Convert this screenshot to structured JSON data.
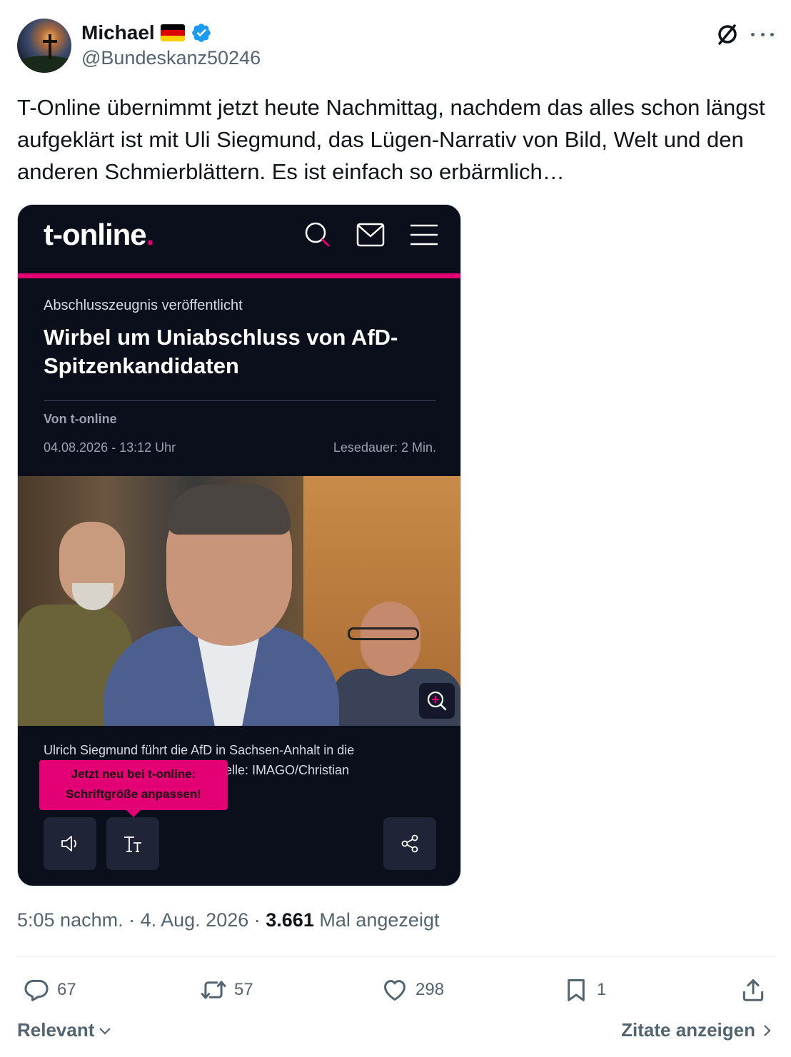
{
  "author": {
    "name": "Michael",
    "handle": "@Bundeskanz50246",
    "flag_colors": [
      "#000000",
      "#dd0000",
      "#ffce00"
    ],
    "verified_color": "#1d9bf0"
  },
  "icons": {
    "grok": "grok-icon",
    "more": "more-icon",
    "reply": "reply-icon",
    "retweet": "retweet-icon",
    "like": "heart-icon",
    "bookmark": "bookmark-icon",
    "share": "share-icon"
  },
  "tweet": {
    "text": "T-Online übernimmt jetzt heute Nachmittag, nachdem das alles schon längst aufgeklärt ist mit Uli Siegmund, das Lügen-Narrativ von Bild, Welt und den anderen Schmierblättern. Es ist einfach so erbärmlich…",
    "time": "5:05 nachm.",
    "date": "4. Aug. 2026",
    "views_count": "3.661",
    "views_label": "Mal angezeigt"
  },
  "embedded": {
    "logo_text": "t-online",
    "logo_dot": ".",
    "accent_color": "#e20074",
    "kicker": "Abschlusszeugnis veröffentlicht",
    "headline": "Wirbel um Uniabschluss von AfD-Spitzenkandidaten",
    "author": "Von t-online",
    "date": "04.08.2026 - 13:12 Uhr",
    "read_time": "Lesedauer: 2 Min.",
    "caption_line1": "Ulrich Siegmund führt die AfD in Sachsen-Anhalt in die",
    "caption_line2": "elle: IMAGO/Christian",
    "tooltip_line1": "Jetzt neu bei t-online:",
    "tooltip_line2": "Schriftgröße anpassen!"
  },
  "actions": {
    "replies": "67",
    "retweets": "57",
    "likes": "298",
    "bookmarks": "1"
  },
  "footer": {
    "sort_label": "Relevant",
    "quotes_label": "Zitate anzeigen"
  }
}
